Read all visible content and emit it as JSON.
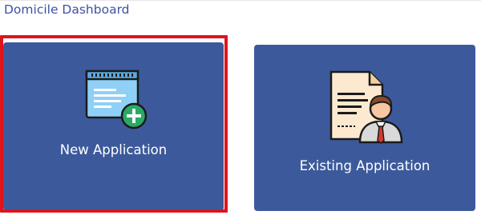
{
  "page": {
    "title": "Domicile Dashboard"
  },
  "cards": {
    "new_application": {
      "label": "New Application",
      "icon": "document-add-icon",
      "selected": true
    },
    "existing_application": {
      "label": "Existing Application",
      "icon": "certificate-person-icon"
    }
  },
  "colors": {
    "card_background": "#3c5a9b",
    "title_text": "#3f51a5",
    "selection_outline": "#e0141d",
    "plus_badge": "#2aa966"
  }
}
